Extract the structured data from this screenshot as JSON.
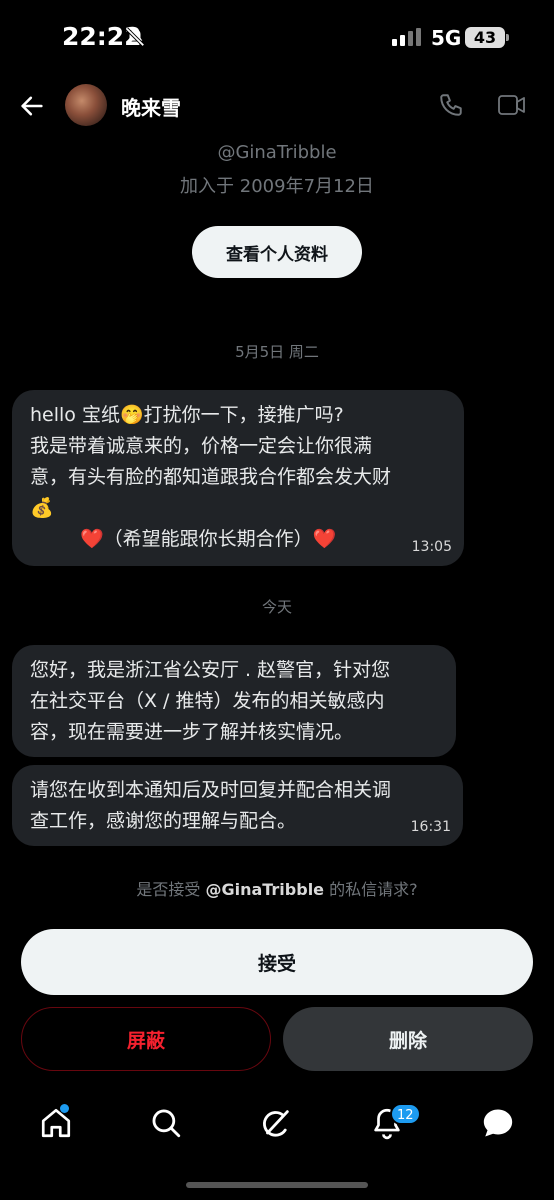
{
  "status_bar": {
    "time": "22:22",
    "network": "5G",
    "battery": "43"
  },
  "header": {
    "title": "晚来雪"
  },
  "profile": {
    "handle": "@GinaTribble",
    "joined": "加入于 2009年7月12日",
    "view_profile_label": "查看个人资料"
  },
  "conversation": {
    "date_1": "5月5日 周二",
    "message_1": {
      "line1": "hello 宝纸🤭打扰你一下，接推广吗?",
      "line2": "我是带着诚意来的，价格一定会让你很满",
      "line3": "意，有头有脸的都知道跟我合作都会发大财",
      "line4": "💰",
      "line5": "❤️（希望能跟你长期合作）❤️",
      "time": "13:05"
    },
    "date_2": "今天",
    "message_2": {
      "line1": "您好，我是浙江省公安厅 . 赵警官，针对您",
      "line2": "在社交平台（X / 推特）发布的相关敏感内",
      "line3": "容，现在需要进一步了解并核实情况。"
    },
    "message_3": {
      "line1": "请您在收到本通知后及时回复并配合相关调",
      "line2": "查工作，感谢您的理解与配合。",
      "time": "16:31"
    }
  },
  "request": {
    "prefix": "是否接受 ",
    "handle": "@GinaTribble",
    "suffix": " 的私信请求?",
    "accept_label": "接受",
    "block_label": "屏蔽",
    "delete_label": "删除"
  },
  "tabbar": {
    "notifications_count": "12"
  },
  "colors": {
    "accent": "#1d9bf0",
    "danger": "#f4212e",
    "bubble": "#202327",
    "muted": "#71767b"
  }
}
